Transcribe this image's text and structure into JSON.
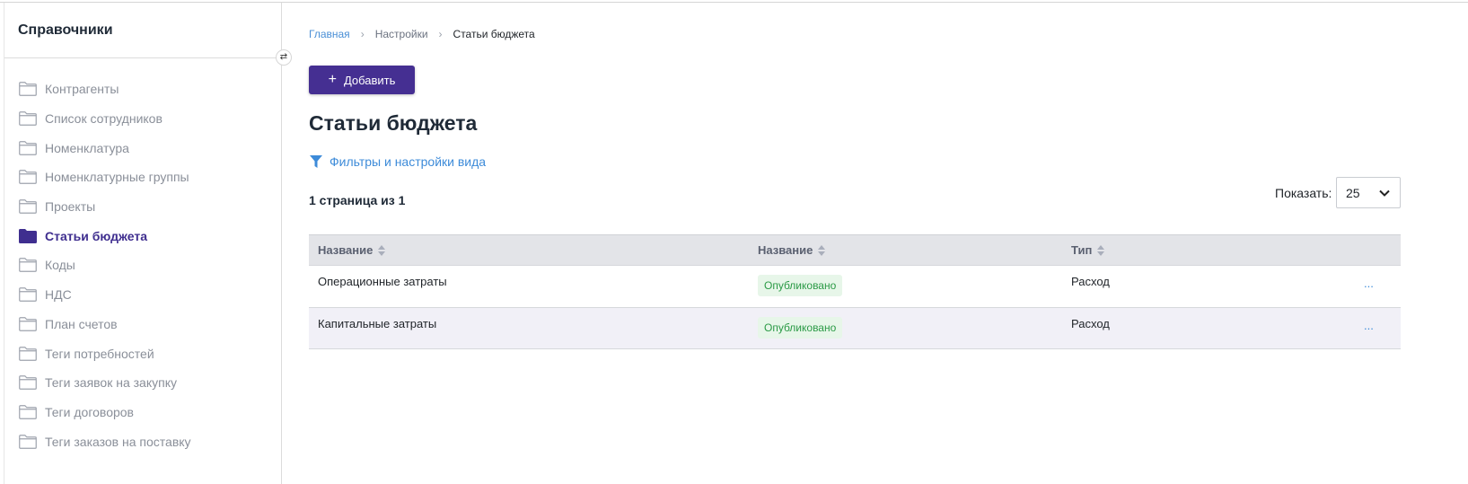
{
  "sidebar": {
    "title": "Справочники",
    "collapse_icon": "collapse-arrows-icon",
    "items": [
      {
        "label": "Контрагенты"
      },
      {
        "label": "Список сотрудников"
      },
      {
        "label": "Номенклатура"
      },
      {
        "label": "Номенклатурные группы"
      },
      {
        "label": "Проекты"
      },
      {
        "label": "Статьи бюджета",
        "active": true
      },
      {
        "label": "Коды"
      },
      {
        "label": "НДС"
      },
      {
        "label": "План счетов"
      },
      {
        "label": "Теги потребностей"
      },
      {
        "label": "Теги заявок на закупку"
      },
      {
        "label": "Теги договоров"
      },
      {
        "label": "Теги заказов на поставку"
      }
    ]
  },
  "breadcrumb": {
    "home": "Главная",
    "settings": "Настройки",
    "current": "Статьи бюджета"
  },
  "toolbar": {
    "add_label": "Добавить"
  },
  "page": {
    "title": "Статьи бюджета",
    "filters_label": "Фильтры и настройки вида",
    "page_info": "1 страница из 1",
    "show_label": "Показать:",
    "show_value": "25"
  },
  "table": {
    "columns": [
      "Название",
      "Название",
      "Тип"
    ],
    "rows": [
      {
        "name": "Операционные затраты",
        "status": "Опубликовано",
        "type": "Расход",
        "actions": "..."
      },
      {
        "name": "Капитальные затраты",
        "status": "Опубликовано",
        "type": "Расход",
        "actions": "..."
      }
    ]
  },
  "colors": {
    "accent": "#452f92",
    "link": "#3d8bd9",
    "status_published_bg": "#e7f6e9",
    "status_published_text": "#2b9a46"
  }
}
